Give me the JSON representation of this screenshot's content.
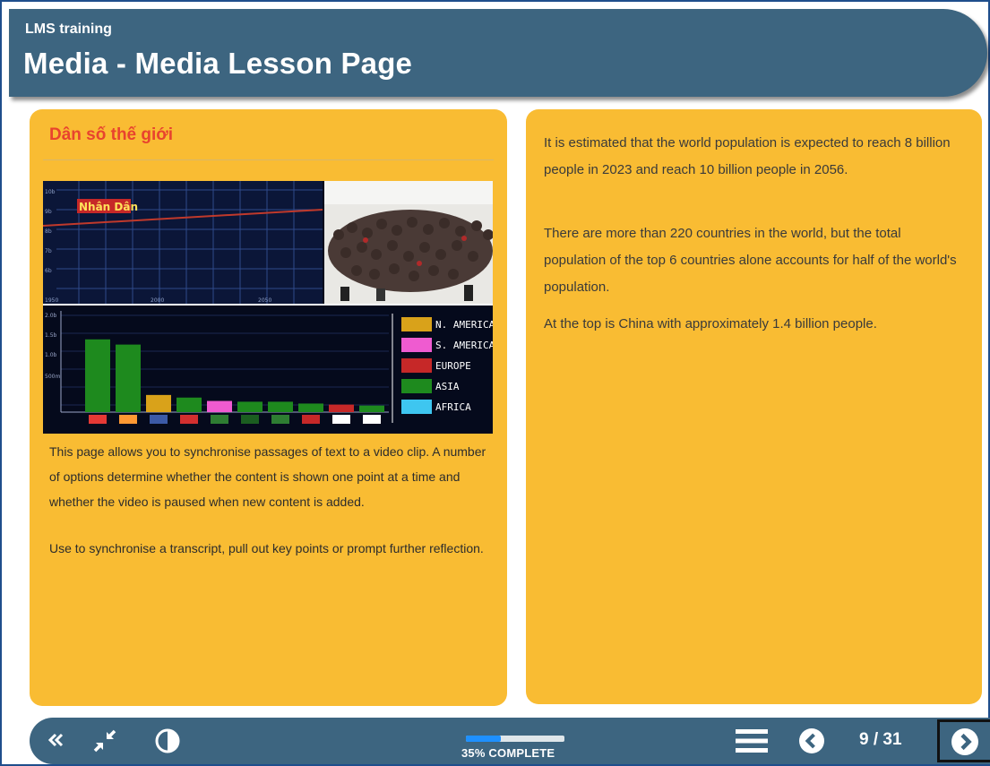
{
  "header": {
    "course_title": "LMS training",
    "page_title": "Media - Media Lesson Page"
  },
  "left_panel": {
    "heading": "Dân số thế giới",
    "video": {
      "overlay_logo": "Nhân Dân",
      "legend": [
        "N. AMERICA",
        "S. AMERICA",
        "EUROPE",
        "ASIA",
        "AFRICA"
      ],
      "legend_colors": [
        "#d9a21a",
        "#ef5bd0",
        "#c62828",
        "#1e8a1e",
        "#3ec6f0"
      ],
      "bar_values": [
        1400,
        1300,
        330,
        280,
        215,
        200,
        200,
        165,
        145,
        126
      ],
      "bar_colors": [
        "#1e8a1e",
        "#1e8a1e",
        "#d9a21a",
        "#1e8a1e",
        "#ef5bd0",
        "#1e8a1e",
        "#1e8a1e",
        "#1e8a1e",
        "#c62828",
        "#1e8a1e"
      ]
    },
    "paragraphs": [
      "This page allows you to synchronise passages of text to a video clip. A number of options determine whether the content is shown one point at a time and whether the video is paused when new content is added.",
      "Use to synchronise a transcript, pull out key points or prompt further reflection."
    ]
  },
  "right_panel": {
    "paragraphs": [
      "It is estimated that the world population is expected to reach 8 billion people in 2023 and reach 10 billion people in 2056.",
      "There are more than 220 countries in the world, but the total population of the top 6 countries alone accounts for half of the world's population.",
      "At the top is China with approximately 1.4 billion people."
    ]
  },
  "footer": {
    "progress_percent": 35,
    "progress_label": "35% COMPLETE",
    "page_counter": "9 / 31",
    "icons": [
      "double-chevron-left-icon",
      "collapse-arrows-icon",
      "contrast-icon",
      "menu-icon",
      "previous-icon",
      "next-icon"
    ]
  },
  "colors": {
    "header_bg": "#3d6580",
    "panel_bg": "#f9bc33",
    "heading_accent": "#e8432e",
    "progress_fill": "#1e90ff"
  }
}
